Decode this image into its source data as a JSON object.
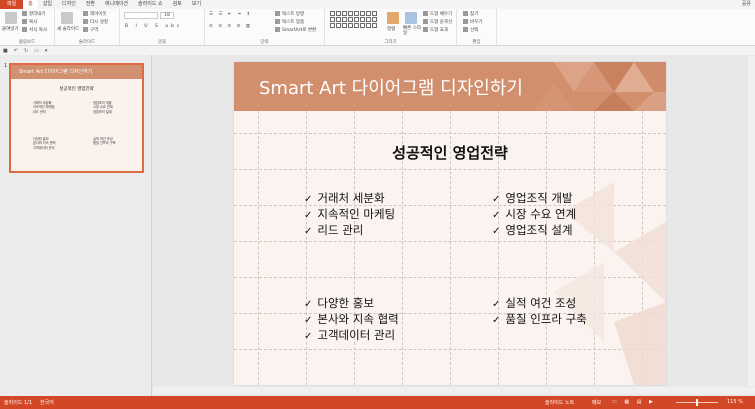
{
  "ribbon_tabs": [
    "파일",
    "홈",
    "삽입",
    "디자인",
    "전환",
    "애니메이션",
    "슬라이드 쇼",
    "검토",
    "보기"
  ],
  "share_label": "공유",
  "ribbon": {
    "clipboard": {
      "paste": "붙여넣기",
      "cut": "잘라내기",
      "copy": "복사",
      "format_painter": "서식 복사",
      "label": "클립보드"
    },
    "slides": {
      "new_slide": "새 슬라이드",
      "layout": "레이아웃",
      "reset": "다시 설정",
      "section": "구역",
      "label": "슬라이드"
    },
    "font": {
      "size": "18",
      "label": "글꼴"
    },
    "paragraph": {
      "text_direction": "텍스트 방향",
      "align_text": "텍스트 맞춤",
      "smartart": "SmartArt로 변환",
      "label": "단락"
    },
    "drawing": {
      "arrange": "정렬",
      "quick_styles": "빠른 스타일",
      "fill": "도형 채우기",
      "outline": "도형 윤곽선",
      "effects": "도형 효과",
      "label": "그리기"
    },
    "editing": {
      "find": "찾기",
      "replace": "바꾸기",
      "select": "선택",
      "label": "편집"
    }
  },
  "thumbnail": {
    "number": "1",
    "title": "Smart Art 다이어그램 디자인하기",
    "subtitle": "성공적인 영업전략",
    "col1a": [
      "거래처 세분화",
      "지속적인 마케팅",
      "리드 관리"
    ],
    "col1b": [
      "영업조직 개발",
      "시장 수요 연계",
      "영업조직 설계"
    ],
    "col2a": [
      "다양한 홍보",
      "본사와 지속 협력",
      "고객데이터 관리"
    ],
    "col2b": [
      "실적 여건 조성",
      "품질 인프라 구축"
    ]
  },
  "slide": {
    "title": "Smart Art 다이어그램 디자인하기",
    "subtitle": "성공적인 영업전략",
    "top_left": [
      "거래처 세분화",
      "지속적인 마케팅",
      "리드 관리"
    ],
    "top_right": [
      "영업조직 개발",
      "시장 수요 연계",
      "영업조직 설계"
    ],
    "bottom_left": [
      "다양한 홍보",
      "본사와 지속 협력",
      "고객데이터 관리"
    ],
    "bottom_right": [
      "실적 여건 조성",
      "품질 인프라 구축"
    ]
  },
  "status": {
    "slide_count": "슬라이드 1/1",
    "language": "한국어",
    "notes": "슬라이드 노트",
    "comments": "메모",
    "zoom": "115 %"
  },
  "colors": {
    "accent": "#d24726",
    "header": "#d18f6e",
    "slide_bg": "#fbf3ef"
  }
}
